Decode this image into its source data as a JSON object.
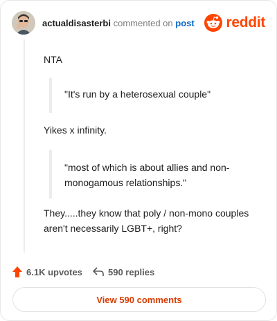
{
  "comment": {
    "username": "actualdisasterbi",
    "action_text": "commented on",
    "post_link": "post",
    "brand": "reddit",
    "brand_color": "#ff4500",
    "paragraphs": {
      "p1": "NTA",
      "q1": "\"It's run by a heterosexual couple\"",
      "p2": "Yikes x infinity.",
      "q2": "\"most of which is about allies and non-monogamous relationships.\"",
      "p3": "They.....they know that poly / non-mono couples aren't necessarily LGBT+, right?"
    }
  },
  "footer": {
    "upvote_icon": "upvote-arrow-icon",
    "upvotes": "6.1K upvotes",
    "reply_icon": "reply-arrow-icon",
    "replies": "590 replies",
    "view_button": "View 590 comments"
  }
}
